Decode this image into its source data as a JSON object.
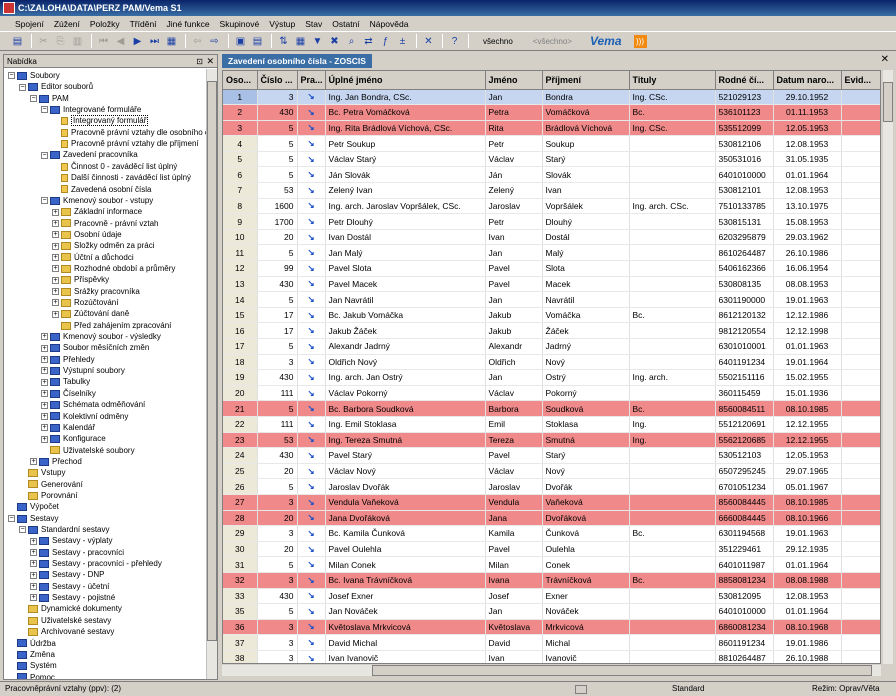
{
  "window": {
    "title": "C:\\ZALOHA\\DATA\\PERZ PAM/Vema S1"
  },
  "menu": [
    "Spojení",
    "Zúžení",
    "Položky",
    "Třídění",
    "Jiné funkce",
    "Skupinové",
    "Výstup",
    "Stav",
    "Ostatní",
    "Nápověda"
  ],
  "toolbar": {
    "filter_value": "všechno",
    "filter_placeholder": "<všechno>",
    "brand": "Vema"
  },
  "nav": {
    "title": "Nabídka",
    "items": [
      {
        "label": "Soubory",
        "level": 0,
        "icon": "blue",
        "exp": "-"
      },
      {
        "label": "Editor souborů",
        "level": 1,
        "icon": "blue",
        "exp": "-"
      },
      {
        "label": "PAM",
        "level": 2,
        "icon": "blue",
        "exp": "-"
      },
      {
        "label": "Integrované formuláře",
        "level": 3,
        "icon": "blue",
        "exp": "-"
      },
      {
        "label": "Integrovaný formulář",
        "level": 4,
        "icon": "doc",
        "exp": "",
        "selected": true
      },
      {
        "label": "Pracovně právní vztahy dle osobního č",
        "level": 4,
        "icon": "doc",
        "exp": ""
      },
      {
        "label": "Pracovně právní vztahy dle příjmení",
        "level": 4,
        "icon": "doc",
        "exp": ""
      },
      {
        "label": "Zavedení pracovníka",
        "level": 3,
        "icon": "blue",
        "exp": "-"
      },
      {
        "label": "Činnost 0 - zaváděcí list úplný",
        "level": 4,
        "icon": "doc",
        "exp": ""
      },
      {
        "label": "Další činnosti - zaváděcí list úplný",
        "level": 4,
        "icon": "doc",
        "exp": ""
      },
      {
        "label": "Zavedená osobní čísla",
        "level": 4,
        "icon": "doc",
        "exp": ""
      },
      {
        "label": "Kmenový soubor - vstupy",
        "level": 3,
        "icon": "blue",
        "exp": "-"
      },
      {
        "label": "Základní informace",
        "level": 4,
        "icon": "folder",
        "exp": "+"
      },
      {
        "label": "Pracovně - právní vztah",
        "level": 4,
        "icon": "folder",
        "exp": "+"
      },
      {
        "label": "Osobní údaje",
        "level": 4,
        "icon": "folder",
        "exp": "+"
      },
      {
        "label": "Složky odměn za práci",
        "level": 4,
        "icon": "folder",
        "exp": "+"
      },
      {
        "label": "Účtní a důchodci",
        "level": 4,
        "icon": "folder",
        "exp": "+"
      },
      {
        "label": "Rozhodné období a průměry",
        "level": 4,
        "icon": "folder",
        "exp": "+"
      },
      {
        "label": "Příspěvky",
        "level": 4,
        "icon": "folder",
        "exp": "+"
      },
      {
        "label": "Srážky pracovníka",
        "level": 4,
        "icon": "folder",
        "exp": "+"
      },
      {
        "label": "Rozúčtování",
        "level": 4,
        "icon": "folder",
        "exp": "+"
      },
      {
        "label": "Zúčtování daně",
        "level": 4,
        "icon": "folder",
        "exp": "+"
      },
      {
        "label": "Před zahájením zpracování",
        "level": 4,
        "icon": "folder",
        "exp": ""
      },
      {
        "label": "Kmenový soubor - výsledky",
        "level": 3,
        "icon": "blue",
        "exp": "+"
      },
      {
        "label": "Soubor měsíčních změn",
        "level": 3,
        "icon": "blue",
        "exp": "+"
      },
      {
        "label": "Přehledy",
        "level": 3,
        "icon": "blue",
        "exp": "+"
      },
      {
        "label": "Výstupní soubory",
        "level": 3,
        "icon": "blue",
        "exp": "+"
      },
      {
        "label": "Tabulky",
        "level": 3,
        "icon": "blue",
        "exp": "+"
      },
      {
        "label": "Číselníky",
        "level": 3,
        "icon": "blue",
        "exp": "+"
      },
      {
        "label": "Schémata odměňování",
        "level": 3,
        "icon": "blue",
        "exp": "+"
      },
      {
        "label": "Kolektivní odměny",
        "level": 3,
        "icon": "blue",
        "exp": "+"
      },
      {
        "label": "Kalendář",
        "level": 3,
        "icon": "blue",
        "exp": "+"
      },
      {
        "label": "Konfigurace",
        "level": 3,
        "icon": "blue",
        "exp": "+"
      },
      {
        "label": "Uživatelské soubory",
        "level": 3,
        "icon": "folder",
        "exp": ""
      },
      {
        "label": "Přechod",
        "level": 2,
        "icon": "blue",
        "exp": "+"
      },
      {
        "label": "Vstupy",
        "level": 1,
        "icon": "folder",
        "exp": ""
      },
      {
        "label": "Generování",
        "level": 1,
        "icon": "folder",
        "exp": ""
      },
      {
        "label": "Porovnání",
        "level": 1,
        "icon": "folder",
        "exp": ""
      },
      {
        "label": "Výpočet",
        "level": 0,
        "icon": "blue",
        "exp": ""
      },
      {
        "label": "Sestavy",
        "level": 0,
        "icon": "blue",
        "exp": "-"
      },
      {
        "label": "Standardní sestavy",
        "level": 1,
        "icon": "blue",
        "exp": "-"
      },
      {
        "label": "Sestavy - výplaty",
        "level": 2,
        "icon": "blue",
        "exp": "+"
      },
      {
        "label": "Sestavy - pracovníci",
        "level": 2,
        "icon": "blue",
        "exp": "+"
      },
      {
        "label": "Sestavy - pracovníci - přehledy",
        "level": 2,
        "icon": "blue",
        "exp": "+"
      },
      {
        "label": "Sestavy - DNP",
        "level": 2,
        "icon": "blue",
        "exp": "+"
      },
      {
        "label": "Sestavy - účetní",
        "level": 2,
        "icon": "blue",
        "exp": "+"
      },
      {
        "label": "Sestavy - pojistné",
        "level": 2,
        "icon": "blue",
        "exp": "+"
      },
      {
        "label": "Dynamické dokumenty",
        "level": 1,
        "icon": "folder",
        "exp": ""
      },
      {
        "label": "Uživatelské sestavy",
        "level": 1,
        "icon": "folder",
        "exp": ""
      },
      {
        "label": "Archivované sestavy",
        "level": 1,
        "icon": "folder",
        "exp": ""
      },
      {
        "label": "Údržba",
        "level": 0,
        "icon": "blue",
        "exp": ""
      },
      {
        "label": "Změna",
        "level": 0,
        "icon": "blue",
        "exp": ""
      },
      {
        "label": "Systém",
        "level": 0,
        "icon": "blue",
        "exp": ""
      },
      {
        "label": "Pomoc",
        "level": 0,
        "icon": "blue",
        "exp": ""
      }
    ]
  },
  "tab": {
    "label": "Zavedení osobního čísla - ZOSCIS"
  },
  "table": {
    "columns": [
      "Oso...",
      "Číslo ...",
      "Pra...",
      "Úplné jméno",
      "Jméno",
      "Příjmení",
      "Tituly",
      "Rodné čí...",
      "Datum naro...",
      "Evid..."
    ],
    "rows": [
      {
        "n": "1",
        "c": "3",
        "full": "Ing. Jan Bondra, CSc.",
        "first": "Jan",
        "last": "Bondra",
        "tit": "Ing. CSc.",
        "rc": "521029123",
        "dob": "29.10.1952",
        "hl": "sel"
      },
      {
        "n": "2",
        "c": "430",
        "full": "Bc. Petra Vomáčková",
        "first": "Petra",
        "last": "Vomáčková",
        "tit": "Bc.",
        "rc": "536101123",
        "dob": "01.11.1953",
        "hl": "red"
      },
      {
        "n": "3",
        "c": "5",
        "full": "Ing. Rita Brádlová Víchová, CSc.",
        "first": "Rita",
        "last": "Brádlová Víchová",
        "tit": "Ing. CSc.",
        "rc": "535512099",
        "dob": "12.05.1953",
        "hl": "red"
      },
      {
        "n": "4",
        "c": "5",
        "full": "Petr Soukup",
        "first": "Petr",
        "last": "Soukup",
        "tit": "",
        "rc": "530812106",
        "dob": "12.08.1953",
        "hl": ""
      },
      {
        "n": "5",
        "c": "5",
        "full": "Václav Starý",
        "first": "Václav",
        "last": "Starý",
        "tit": "",
        "rc": "350531016",
        "dob": "31.05.1935",
        "hl": ""
      },
      {
        "n": "6",
        "c": "5",
        "full": "Ján Slovák",
        "first": "Ján",
        "last": "Slovák",
        "tit": "",
        "rc": "6401010000",
        "dob": "01.01.1964",
        "hl": ""
      },
      {
        "n": "7",
        "c": "53",
        "full": "Zelený Ivan",
        "first": "Zelený",
        "last": "Ivan",
        "tit": "",
        "rc": "530812101",
        "dob": "12.08.1953",
        "hl": ""
      },
      {
        "n": "8",
        "c": "1600",
        "full": "Ing. arch. Jaroslav Vopršálek, CSc.",
        "first": "Jaroslav",
        "last": "Vopršálek",
        "tit": "Ing. arch. CSc.",
        "rc": "7510133785",
        "dob": "13.10.1975",
        "hl": ""
      },
      {
        "n": "9",
        "c": "1700",
        "full": "Petr Dlouhý",
        "first": "Petr",
        "last": "Dlouhý",
        "tit": "",
        "rc": "530815131",
        "dob": "15.08.1953",
        "hl": ""
      },
      {
        "n": "10",
        "c": "20",
        "full": "Ivan Dostál",
        "first": "Ivan",
        "last": "Dostál",
        "tit": "",
        "rc": "6203295879",
        "dob": "29.03.1962",
        "hl": ""
      },
      {
        "n": "11",
        "c": "5",
        "full": "Jan Malý",
        "first": "Jan",
        "last": "Malý",
        "tit": "",
        "rc": "8610264487",
        "dob": "26.10.1986",
        "hl": ""
      },
      {
        "n": "12",
        "c": "99",
        "full": "Pavel Slota",
        "first": "Pavel",
        "last": "Slota",
        "tit": "",
        "rc": "5406162366",
        "dob": "16.06.1954",
        "hl": ""
      },
      {
        "n": "13",
        "c": "430",
        "full": "Pavel Macek",
        "first": "Pavel",
        "last": "Macek",
        "tit": "",
        "rc": "530808135",
        "dob": "08.08.1953",
        "hl": ""
      },
      {
        "n": "14",
        "c": "5",
        "full": "Jan Navrátil",
        "first": "Jan",
        "last": "Navrátil",
        "tit": "",
        "rc": "6301190000",
        "dob": "19.01.1963",
        "hl": ""
      },
      {
        "n": "15",
        "c": "17",
        "full": "Bc. Jakub Vomáčka",
        "first": "Jakub",
        "last": "Vomáčka",
        "tit": "Bc.",
        "rc": "8612120132",
        "dob": "12.12.1986",
        "hl": ""
      },
      {
        "n": "16",
        "c": "17",
        "full": "Jakub Žáček",
        "first": "Jakub",
        "last": "Žáček",
        "tit": "",
        "rc": "9812120554",
        "dob": "12.12.1998",
        "hl": ""
      },
      {
        "n": "17",
        "c": "5",
        "full": "Alexandr Jadrný",
        "first": "Alexandr",
        "last": "Jadrný",
        "tit": "",
        "rc": "6301010001",
        "dob": "01.01.1963",
        "hl": ""
      },
      {
        "n": "18",
        "c": "3",
        "full": "Oldřich Nový",
        "first": "Oldřich",
        "last": "Nový",
        "tit": "",
        "rc": "6401191234",
        "dob": "19.01.1964",
        "hl": ""
      },
      {
        "n": "19",
        "c": "430",
        "full": "Ing. arch. Jan Ostrý",
        "first": "Jan",
        "last": "Ostrý",
        "tit": "Ing. arch.",
        "rc": "5502151116",
        "dob": "15.02.1955",
        "hl": ""
      },
      {
        "n": "20",
        "c": "111",
        "full": "Václav Pokorný",
        "first": "Václav",
        "last": "Pokorný",
        "tit": "",
        "rc": "360115459",
        "dob": "15.01.1936",
        "hl": ""
      },
      {
        "n": "21",
        "c": "5",
        "full": "Bc. Barbora Soudková",
        "first": "Barbora",
        "last": "Soudková",
        "tit": "Bc.",
        "rc": "8560084511",
        "dob": "08.10.1985",
        "hl": "red"
      },
      {
        "n": "22",
        "c": "111",
        "full": "Ing. Emil Stoklasa",
        "first": "Emil",
        "last": "Stoklasa",
        "tit": "Ing.",
        "rc": "5512120691",
        "dob": "12.12.1955",
        "hl": ""
      },
      {
        "n": "23",
        "c": "53",
        "full": "Ing. Tereza Smutná",
        "first": "Tereza",
        "last": "Smutná",
        "tit": "Ing.",
        "rc": "5562120685",
        "dob": "12.12.1955",
        "hl": "red"
      },
      {
        "n": "24",
        "c": "430",
        "full": "Pavel Starý",
        "first": "Pavel",
        "last": "Starý",
        "tit": "",
        "rc": "530512103",
        "dob": "12.05.1953",
        "hl": ""
      },
      {
        "n": "25",
        "c": "20",
        "full": "Václav Nový",
        "first": "Václav",
        "last": "Nový",
        "tit": "",
        "rc": "6507295245",
        "dob": "29.07.1965",
        "hl": ""
      },
      {
        "n": "26",
        "c": "5",
        "full": "Jaroslav Dvořák",
        "first": "Jaroslav",
        "last": "Dvořák",
        "tit": "",
        "rc": "6701051234",
        "dob": "05.01.1967",
        "hl": ""
      },
      {
        "n": "27",
        "c": "3",
        "full": "Vendula Vaňeková",
        "first": "Vendula",
        "last": "Vaňeková",
        "tit": "",
        "rc": "8560084445",
        "dob": "08.10.1985",
        "hl": "red"
      },
      {
        "n": "28",
        "c": "20",
        "full": "Jana Dvořáková",
        "first": "Jana",
        "last": "Dvořáková",
        "tit": "",
        "rc": "6660084445",
        "dob": "08.10.1966",
        "hl": "red"
      },
      {
        "n": "29",
        "c": "3",
        "full": "Bc. Kamila Čunková",
        "first": "Kamila",
        "last": "Čunková",
        "tit": "Bc.",
        "rc": "6301194568",
        "dob": "19.01.1963",
        "hl": ""
      },
      {
        "n": "30",
        "c": "20",
        "full": "Pavel Oulehla",
        "first": "Pavel",
        "last": "Oulehla",
        "tit": "",
        "rc": "351229461",
        "dob": "29.12.1935",
        "hl": ""
      },
      {
        "n": "31",
        "c": "5",
        "full": "Milan Conek",
        "first": "Milan",
        "last": "Conek",
        "tit": "",
        "rc": "6401011987",
        "dob": "01.01.1964",
        "hl": ""
      },
      {
        "n": "32",
        "c": "3",
        "full": "Bc. Ivana Trávníčková",
        "first": "Ivana",
        "last": "Trávníčková",
        "tit": "Bc.",
        "rc": "8858081234",
        "dob": "08.08.1988",
        "hl": "red"
      },
      {
        "n": "33",
        "c": "430",
        "full": "Josef Exner",
        "first": "Josef",
        "last": "Exner",
        "tit": "",
        "rc": "530812095",
        "dob": "12.08.1953",
        "hl": ""
      },
      {
        "n": "35",
        "c": "5",
        "full": "Jan Nováček",
        "first": "Jan",
        "last": "Nováček",
        "tit": "",
        "rc": "6401010000",
        "dob": "01.01.1964",
        "hl": ""
      },
      {
        "n": "36",
        "c": "3",
        "full": "Květoslava Mrkvicová",
        "first": "Květoslava",
        "last": "Mrkvicová",
        "tit": "",
        "rc": "6860081234",
        "dob": "08.10.1968",
        "hl": "red"
      },
      {
        "n": "37",
        "c": "3",
        "full": "David Michal",
        "first": "David",
        "last": "Michal",
        "tit": "",
        "rc": "8601191234",
        "dob": "19.01.1986",
        "hl": ""
      },
      {
        "n": "38",
        "c": "3",
        "full": "Ivan Ivanovič",
        "first": "Ivan",
        "last": "Ivanovič",
        "tit": "",
        "rc": "8810264487",
        "dob": "26.10.1988",
        "hl": ""
      }
    ]
  },
  "status": {
    "left": "Pracovněprávní vztahy (ppv): (2)",
    "center": "Standard",
    "right": "Režim: Oprav/Věta"
  }
}
